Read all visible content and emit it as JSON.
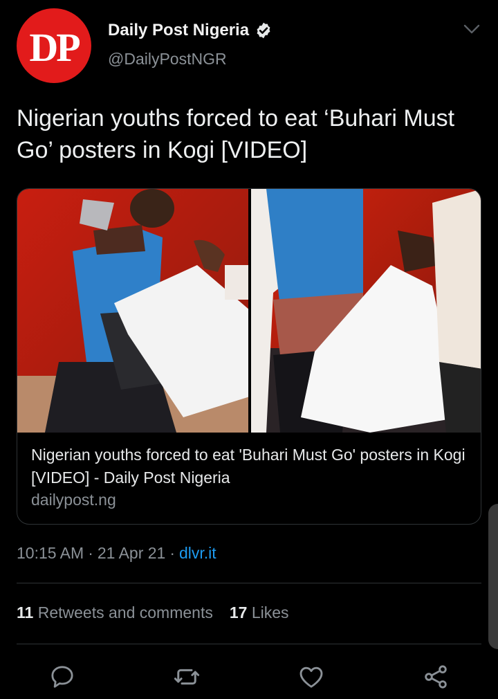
{
  "tweet": {
    "author": {
      "avatar_text": "DP",
      "display_name": "Daily Post Nigeria",
      "handle": "@DailyPostNGR",
      "verified": true
    },
    "text": "Nigerian youths forced to eat ‘Buhari Must Go’ posters in Kogi [VIDEO]",
    "card": {
      "title": "Nigerian youths forced to eat 'Buhari Must Go' posters in Kogi [VIDEO] - Daily Post Nigeria",
      "domain": "dailypost.ng"
    },
    "time": "10:15 AM",
    "date": "21 Apr 21",
    "source": "dlvr.it",
    "separator": "·",
    "stats": {
      "retweets_count": "11",
      "retweets_label": "Retweets and comments",
      "likes_count": "17",
      "likes_label": "Likes"
    }
  },
  "icons": {
    "more": "chevron-down-icon",
    "verified": "verified-badge-icon",
    "reply": "reply-icon",
    "retweet": "retweet-icon",
    "like": "heart-icon",
    "share": "share-icon"
  },
  "colors": {
    "background": "#000000",
    "brand_red": "#e21b1b",
    "link_blue": "#1d9bf0",
    "muted": "#8b9197"
  }
}
